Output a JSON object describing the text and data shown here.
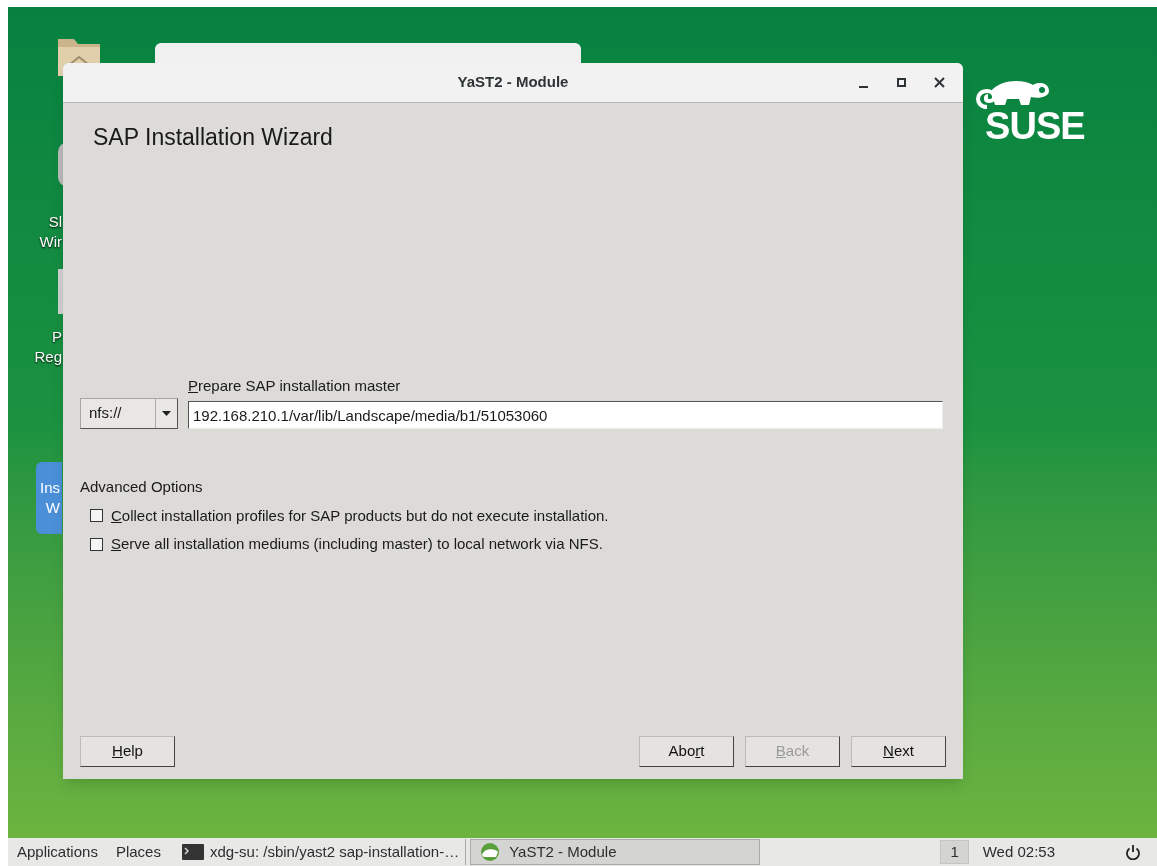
{
  "desktop": {
    "icons": [
      {
        "label_lines": [
          "Sl",
          "Wir"
        ],
        "selected": false
      },
      {
        "label_lines": [
          "P",
          "Reg"
        ],
        "selected": false
      },
      {
        "label_lines": [
          "Ins",
          "W"
        ],
        "selected": true
      }
    ],
    "logo": {
      "text": "SUSE"
    }
  },
  "window": {
    "title": "YaST2 - Module",
    "heading": "SAP Installation Wizard",
    "source": {
      "label": {
        "key": "P",
        "after": "repare SAP installation master"
      },
      "scheme": "nfs://",
      "value": "192.168.210.1/var/lib/Landscape/media/b1/51053060"
    },
    "advanced": {
      "title": "Advanced Options",
      "options": [
        {
          "label": {
            "key": "C",
            "after": "ollect installation profiles for SAP products but do not execute installation."
          },
          "checked": false
        },
        {
          "label": {
            "key": "S",
            "after": "erve all installation mediums (including master) to local network via NFS."
          },
          "checked": false
        }
      ]
    },
    "buttons": [
      {
        "label": {
          "key": "H",
          "after": "elp"
        },
        "kind": "help",
        "disabled": false
      },
      {
        "label": {
          "before": "Abo",
          "key": "r",
          "after": "t"
        },
        "kind": "nav",
        "disabled": false
      },
      {
        "label": {
          "key": "B",
          "after": "ack"
        },
        "kind": "nav",
        "disabled": true
      },
      {
        "label": {
          "key": "N",
          "after": "ext"
        },
        "kind": "nav",
        "disabled": false
      }
    ]
  },
  "taskbar": {
    "menus": [
      "Applications",
      "Places"
    ],
    "tasks": [
      {
        "label": "xdg-su: /sbin/yast2 sap-installation-…",
        "kind": "terminal",
        "selected": false
      },
      {
        "label": "YaST2 - Module",
        "kind": "yast",
        "selected": true
      }
    ],
    "workspace": "1",
    "clock": "Wed 02:53"
  }
}
